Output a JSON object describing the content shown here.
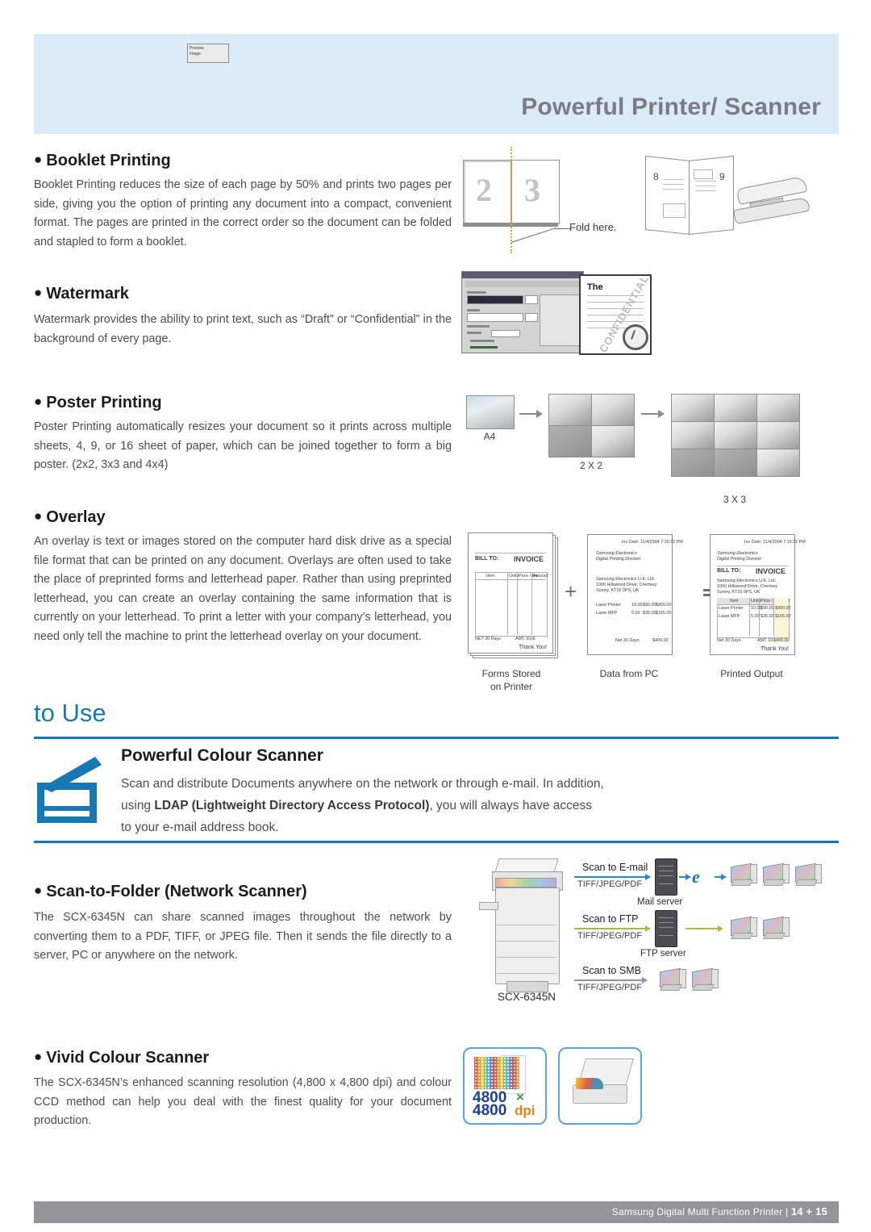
{
  "header": {
    "title": "Powerful Printer/ Scanner"
  },
  "sections": [
    {
      "id": "booklet",
      "heading": "Booklet Printing",
      "body": "Booklet Printing reduces the size of each page by 50% and prints two pages per side, giving you the option of printing any document into a compact, convenient format. The pages are printed in the correct order so the document can be folded and stapled to form a booklet."
    },
    {
      "id": "watermark",
      "heading": "Watermark",
      "body": "Watermark provides the ability to print text, such as “Draft” or “Confidential” in the background of every page."
    },
    {
      "id": "poster",
      "heading": "Poster Printing",
      "body": "Poster Printing automatically resizes your document so it prints across multiple sheets, 4, 9, or 16 sheet of paper, which can be joined together to form a big poster. (2x2, 3x3 and 4x4)"
    },
    {
      "id": "overlay",
      "heading": "Overlay",
      "body": "An overlay is text or images stored on the computer hard disk drive as a special file format that can be printed on any document. Overlays are often used to take the place of preprinted forms and letterhead paper. Rather than using preprinted letterhead, you can create an overlay containing the same information that is currently on your letterhead. To print a letter with your company’s letterhead, you need only tell the machine to print the letterhead overlay on your document."
    },
    {
      "id": "scan-to-folder",
      "heading": "Scan-to-Folder (Network Scanner)",
      "body": "The SCX-6345N can share scanned images throughout the network by converting them to a PDF, TIFF, or JPEG file. Then it sends the file directly to a server, PC or anywhere on the network."
    },
    {
      "id": "vivid",
      "heading": "Vivid Colour Scanner",
      "body": "The SCX-6345N’s enhanced scanning resolution (4,800 x 4,800 dpi) and colour CCD method can help you deal with the finest quality for your document production."
    }
  ],
  "booklet_illustration": {
    "page_left_number": "2",
    "page_right_number": "3",
    "fold_label": "Fold here.",
    "booklet_page_left": "8",
    "booklet_page_right": "9"
  },
  "watermark_illustration": {
    "doc_word": "The",
    "watermark_text": "CONFIDENTIAL",
    "callout_line1": "Preview",
    "callout_line2": "Image"
  },
  "poster_illustration": {
    "source_label": "A4",
    "grid_2x2_label": "2 X 2",
    "grid_3x3_label": "3 X 3"
  },
  "overlay_illustration": {
    "caption_1_line1": "Forms Stored",
    "caption_1_line2": "on Printer",
    "caption_2": "Data from PC",
    "caption_3": "Printed Output",
    "plus_symbol": "+",
    "form": {
      "bill_to": "BILL TO:",
      "invoice": "INVOICE",
      "thank_you": "Thank You!",
      "col_item": "Item",
      "col_qty": "Units",
      "col_price": "Price / Ea.",
      "col_amount": "Amount",
      "terms": "NET 30 Days",
      "amt_due": "AMT. DUE"
    },
    "data": {
      "inv_date": "Inv Date: 11/4/2004 7:19:32 PM",
      "company_line1": "Samsung Electronics",
      "company_line2": "Digital Printing Division",
      "addr_line1": "Samsung Electronics U.K. Ltd.",
      "addr_line2": "1000 Hillswood Drive, Chertsey",
      "addr_line3": "Surrey, KT16 0PS, UK",
      "item1": "Laser Printer",
      "item1_qty": "10.00",
      "item1_price": "$90.00",
      "item1_amt": "$900.00",
      "item2": "Laser MFP",
      "item2_qty": "5.00",
      "item2_price": "$35.00",
      "item2_amt": "$165.00",
      "terms": "Net 30 Days",
      "total": "$400.00"
    }
  },
  "to_use": {
    "label": "to Use"
  },
  "powerful_colour_scanner": {
    "title": "Powerful Colour Scanner",
    "line1": "Scan and distribute Documents anywhere on the network or through e-mail. In addition,",
    "line2_pre": "using ",
    "line2_bold": "LDAP (Lightweight Directory Access Protocol)",
    "line2_post": ", you will always have access",
    "line3": "to your e-mail address book."
  },
  "scan_diagram": {
    "device_label": "SCX-6345N",
    "flows": [
      {
        "label": "Scan to E-mail",
        "formats": "TIFF/JPEG/PDF",
        "server": "Mail server",
        "colour": "#2f87c4",
        "clients": 3
      },
      {
        "label": "Scan to FTP",
        "formats": "TIFF/JPEG/PDF",
        "server": "FTP server",
        "colour": "#b9b14a",
        "clients": 2
      },
      {
        "label": "Scan to SMB",
        "formats": "TIFF/JPEG/PDF",
        "server": "",
        "colour": "#8d93b8",
        "clients": 2
      }
    ],
    "browser_icon": "e"
  },
  "vivid_icons": {
    "dpi_line1": "4800",
    "dpi_line2": "4800",
    "dpi_x": "×",
    "dpi_unit": "dpi"
  },
  "footer": {
    "text": "Samsung Digital Multi Function Printer",
    "separator": "|",
    "pages": "14 + 15"
  },
  "colors": {
    "banner": "#dcebf8",
    "accent_blue": "#1878b4",
    "footer_gray": "#949499",
    "heading_dark": "#1c1c1c",
    "body_gray": "#4d4d4d"
  }
}
